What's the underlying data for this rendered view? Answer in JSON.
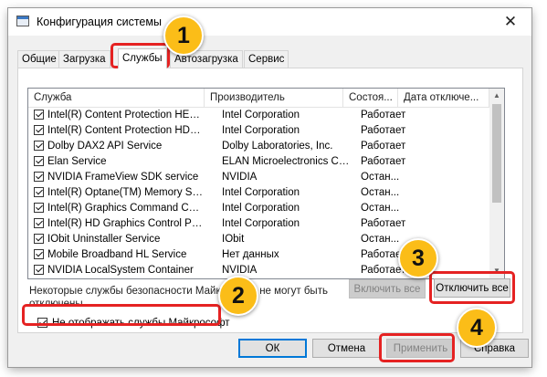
{
  "window": {
    "title": "Конфигурация системы",
    "close_glyph": "✕"
  },
  "tabs": [
    "Общие",
    "Загрузка",
    "Службы",
    "Автозагрузка",
    "Сервис"
  ],
  "active_tab": "Службы",
  "columns": [
    "Служба",
    "Производитель",
    "Состоя...",
    "Дата отключе..."
  ],
  "services": [
    {
      "name": "Intel(R) Content Protection HEC...",
      "maker": "Intel Corporation",
      "status": "Работает",
      "checked": true
    },
    {
      "name": "Intel(R) Content Protection HDC...",
      "maker": "Intel Corporation",
      "status": "Работает",
      "checked": true
    },
    {
      "name": "Dolby DAX2 API Service",
      "maker": "Dolby Laboratories, Inc.",
      "status": "Работает",
      "checked": true
    },
    {
      "name": "Elan Service",
      "maker": "ELAN Microelectronics Corp.",
      "status": "Работает",
      "checked": true
    },
    {
      "name": "NVIDIA FrameView SDK service",
      "maker": "NVIDIA",
      "status": "Остан...",
      "checked": true
    },
    {
      "name": "Intel(R) Optane(TM) Memory Se...",
      "maker": "Intel Corporation",
      "status": "Остан...",
      "checked": true
    },
    {
      "name": "Intel(R) Graphics Command Cen...",
      "maker": "Intel Corporation",
      "status": "Остан...",
      "checked": true
    },
    {
      "name": "Intel(R) HD Graphics Control Pa...",
      "maker": "Intel Corporation",
      "status": "Работает",
      "checked": true
    },
    {
      "name": "IObit Uninstaller Service",
      "maker": "IObit",
      "status": "Остан...",
      "checked": true
    },
    {
      "name": "Mobile Broadband HL Service",
      "maker": "Нет данных",
      "status": "Работает",
      "checked": true
    },
    {
      "name": "NVIDIA LocalSystem Container",
      "maker": "NVIDIA",
      "status": "Работает",
      "checked": true
    }
  ],
  "note": "Некоторые службы безопасности Майкрософт не могут быть отключены.",
  "enable_all": "Включить все",
  "disable_all": "Отключить все",
  "hide_ms": {
    "label": "Не отображать службы Майкрософт",
    "checked": true
  },
  "buttons": {
    "ok": "ОК",
    "cancel": "Отмена",
    "apply": "Применить",
    "help": "Справка"
  },
  "badges": [
    "1",
    "2",
    "3",
    "4"
  ],
  "highlight_color": "#e52222",
  "badge_color": "#fbbd18"
}
